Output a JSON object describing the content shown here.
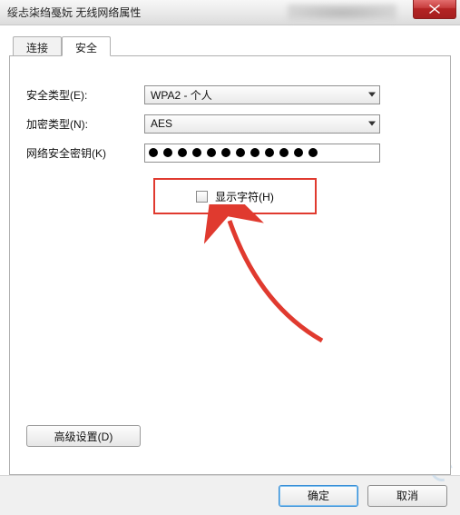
{
  "titlebar": {
    "title": "绥忐柒绉戞妧 无线网络属性"
  },
  "tabs": {
    "connect": "连接",
    "security": "安全"
  },
  "form": {
    "security_type_label": "安全类型(E):",
    "security_type_value": "WPA2 - 个人",
    "encryption_label": "加密类型(N):",
    "encryption_value": "AES",
    "key_label": "网络安全密钥(K)",
    "key_dots": 12,
    "show_chars_label": "显示字符(H)",
    "advanced_label": "高级设置(D)"
  },
  "footer": {
    "ok": "确定",
    "cancel": "取消"
  }
}
